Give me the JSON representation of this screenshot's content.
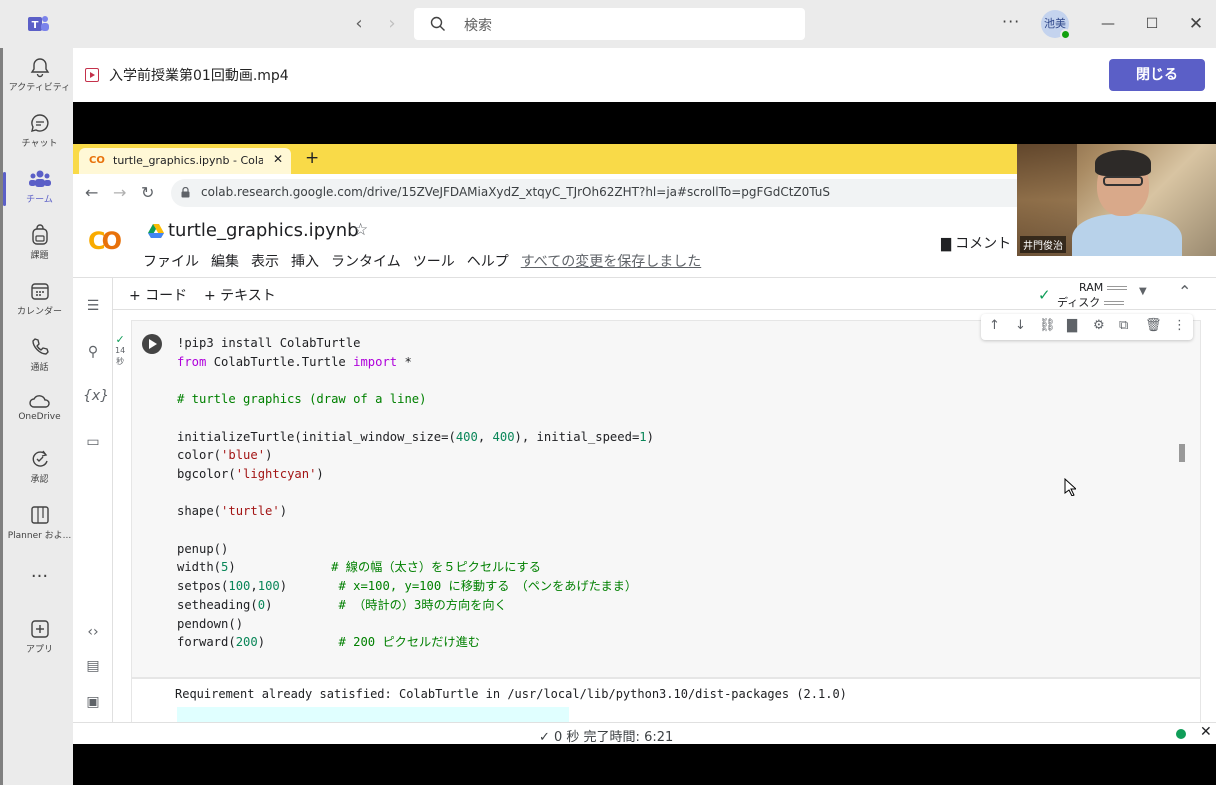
{
  "teams": {
    "search_placeholder": "検索",
    "more": "···",
    "avatar_initials": "池美",
    "rail": [
      {
        "label": "アクティビティ",
        "icon": "bell-icon"
      },
      {
        "label": "チャット",
        "icon": "chat-icon"
      },
      {
        "label": "チーム",
        "icon": "teams-icon"
      },
      {
        "label": "課題",
        "icon": "backpack-icon"
      },
      {
        "label": "カレンダー",
        "icon": "calendar-icon"
      },
      {
        "label": "通話",
        "icon": "phone-icon"
      },
      {
        "label": "OneDrive",
        "icon": "cloud-icon"
      },
      {
        "label": "承認",
        "icon": "approval-icon"
      },
      {
        "label": "Planner およ...",
        "icon": "planner-icon"
      },
      {
        "label": "アプリ",
        "icon": "add-app-icon"
      }
    ],
    "meeting_file_title": "入学前授業第01回動画.mp4",
    "close_label": "閉じる"
  },
  "browser": {
    "tab_title": "turtle_graphics.ipynb - Colabora",
    "url": "colab.research.google.com/drive/15ZVeJFDAMiaXydZ_xtqyC_TJrOh62ZHT?hl=ja#scrollTo=pgFGdCtZ0TuS"
  },
  "colab": {
    "notebook_title": "turtle_graphics.ipynb",
    "menu": [
      "ファイル",
      "編集",
      "表示",
      "挿入",
      "ランタイム",
      "ツール",
      "ヘルプ"
    ],
    "saved_status": "すべての変更を保存しました",
    "comment_label": "コメント",
    "add_code": "+ コード",
    "add_text": "+ テキスト",
    "ram_label": "RAM",
    "disk_label": "ディスク",
    "exec_seconds": "14",
    "exec_unit": "秒",
    "output_text": "Requirement already satisfied: ColabTurtle in /usr/local/lib/python3.10/dist-packages (2.1.0)",
    "status_text": "✓  0 秒    完了時間: 6:21"
  },
  "webcam": {
    "name": "井門俊治"
  }
}
